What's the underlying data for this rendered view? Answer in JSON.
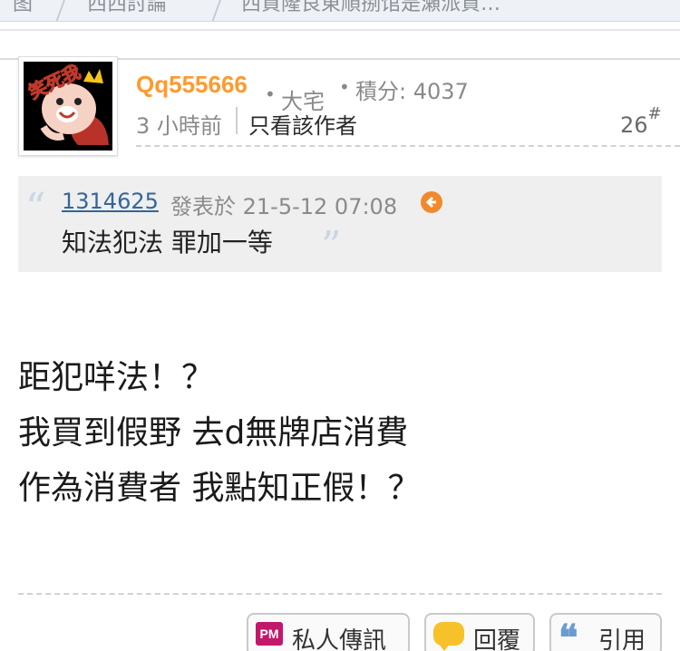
{
  "breadcrumb": {
    "items": [
      "图",
      "西西討論",
      "西貢隆良東順捌馆是瀬派貨…"
    ]
  },
  "post": {
    "author": "Qq555666",
    "rank": "大宅",
    "credits": "積分: 4037",
    "time": "3 小時前",
    "only_author_label": "只看該作者",
    "floor": "26",
    "floor_mark": "#",
    "avatar_text": "笑死我",
    "quote": {
      "open_mark": "“",
      "close_mark": "”",
      "user": "1314625",
      "meta": "發表於 21-5-12 07:08",
      "text": "知法犯法 罪加一等"
    },
    "body_lines": [
      "距犯咩法！？",
      "我買到假野 去d無牌店消費",
      "作為消費者 我點知正假！？"
    ]
  },
  "actions": {
    "pm_icon": "PM",
    "pm_label": "私人傳訊",
    "reply_label": "回覆",
    "quote_icon": "❝",
    "quote_label": "引用"
  },
  "colors": {
    "author": "#ff9a2e",
    "quote_user": "#336699",
    "quote_bg": "#efefef",
    "pm_icon": "#c2186b",
    "reply_icon": "#f7c12a",
    "quote_icon": "#6b9bd1"
  }
}
